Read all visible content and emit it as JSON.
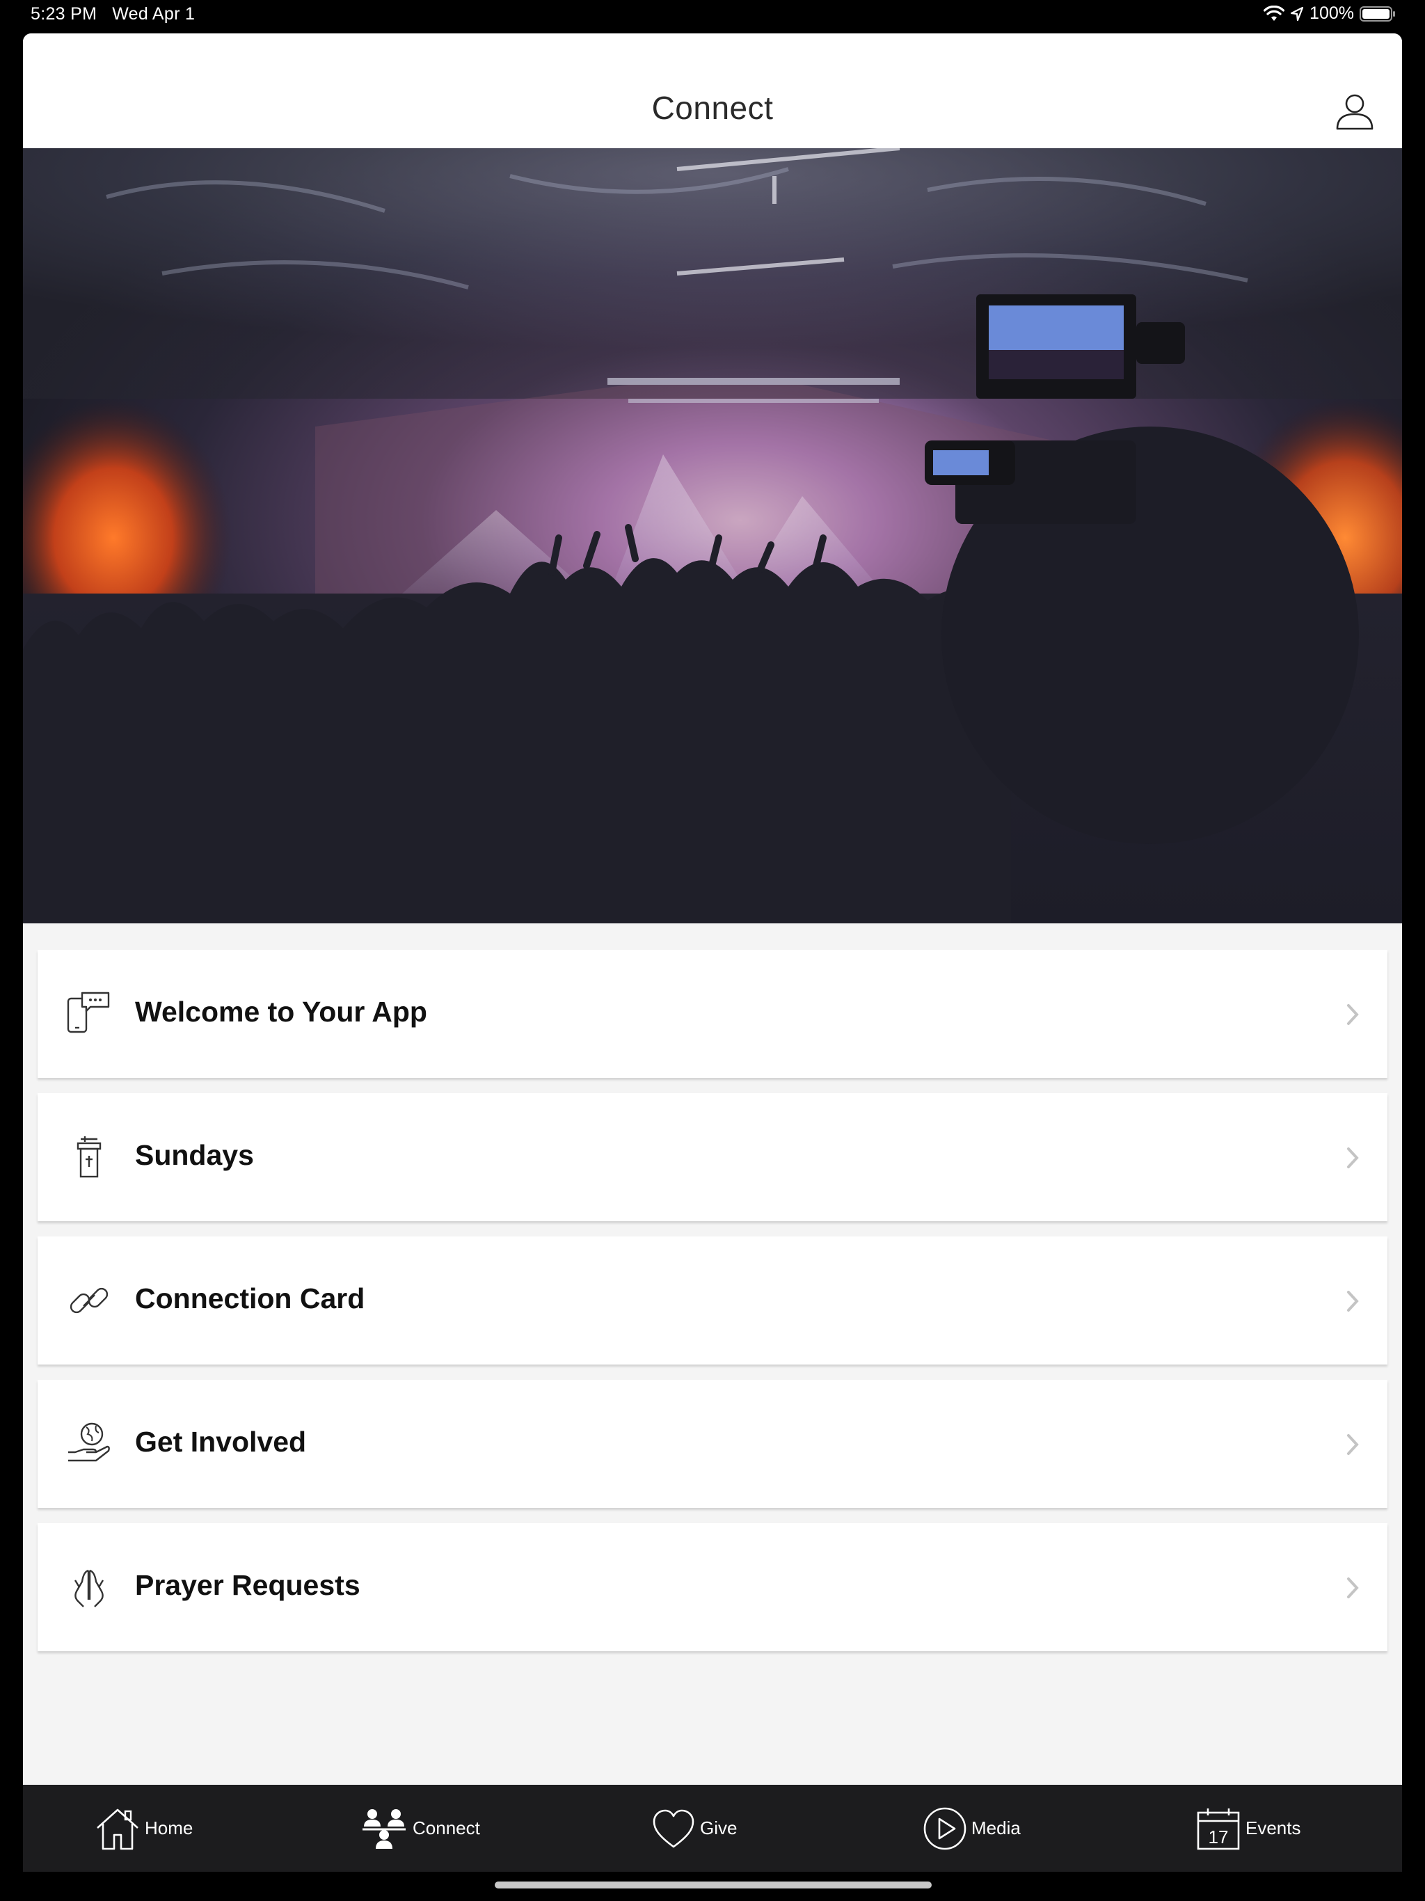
{
  "status_bar": {
    "time": "5:23 PM",
    "date": "Wed Apr 1",
    "battery": "100%",
    "icons": [
      "wifi-icon",
      "location-icon",
      "battery-icon"
    ]
  },
  "header": {
    "title": "Connect",
    "profile_icon": "user-profile-icon"
  },
  "hero": {
    "description_icon": "concert-photo"
  },
  "menu": {
    "items": [
      {
        "label": "Welcome to Your App",
        "icon": "phone-chat-icon"
      },
      {
        "label": "Sundays",
        "icon": "pulpit-icon"
      },
      {
        "label": "Connection Card",
        "icon": "link-icon"
      },
      {
        "label": "Get Involved",
        "icon": "globe-hand-icon"
      },
      {
        "label": "Prayer Requests",
        "icon": "praying-hands-icon"
      }
    ]
  },
  "tab_bar": {
    "tabs": [
      {
        "label": "Home",
        "icon": "home-icon"
      },
      {
        "label": "Connect",
        "icon": "people-icon"
      },
      {
        "label": "Give",
        "icon": "heart-icon"
      },
      {
        "label": "Media",
        "icon": "play-icon"
      },
      {
        "label": "Events",
        "icon": "calendar-icon",
        "icon_text": "17"
      }
    ]
  },
  "colors": {
    "tab_bar_bg": "#1c1c1e",
    "page_bg": "#f4f4f4",
    "card_bg": "#ffffff",
    "chevron": "#c4c4c4"
  }
}
